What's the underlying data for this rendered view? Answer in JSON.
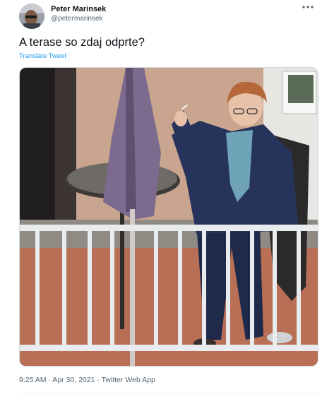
{
  "author": {
    "display_name": "Peter Marinsek",
    "handle": "@petermarinsek"
  },
  "tweet": {
    "text": "A terase so zdaj odprte?",
    "translate_label": "Translate Tweet"
  },
  "meta": {
    "time": "9:25 AM",
    "separator1": " · ",
    "date": "Apr 30, 2021",
    "separator2": " · ",
    "client": "Twitter Web App"
  },
  "icons": {
    "more": "more-horizontal-icon"
  }
}
